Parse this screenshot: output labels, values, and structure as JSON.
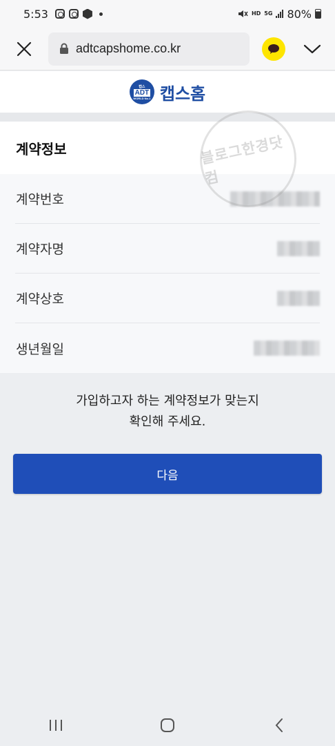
{
  "status": {
    "time": "5:53",
    "hd_label": "HD",
    "g_label": "5G",
    "battery": "80%"
  },
  "browser": {
    "url": "adtcapshome.co.kr"
  },
  "brand": {
    "badge_top": "캡스",
    "badge_mid": "ADT",
    "badge_bottom": "WORLD No.1",
    "name": "캡스홈",
    "color": "#1f4ea3"
  },
  "contract": {
    "title": "계약정보",
    "rows": [
      {
        "label": "계약번호"
      },
      {
        "label": "계약자명"
      },
      {
        "label": "계약상호"
      },
      {
        "label": "생년월일"
      }
    ]
  },
  "notice": {
    "line1": "가입하고자 하는 계약정보가 맞는지",
    "line2": "확인해 주세요."
  },
  "actions": {
    "next_label": "다음",
    "color": "#1f4eb8"
  },
  "watermark": {
    "text": "블로그한경닷컴"
  },
  "icons": {
    "close": "close-icon",
    "lock": "lock-icon",
    "kakaotalk": "kakaotalk-icon",
    "chevron": "chevron-down-icon",
    "recents": "recents-icon",
    "home": "home-icon",
    "back": "back-icon"
  }
}
